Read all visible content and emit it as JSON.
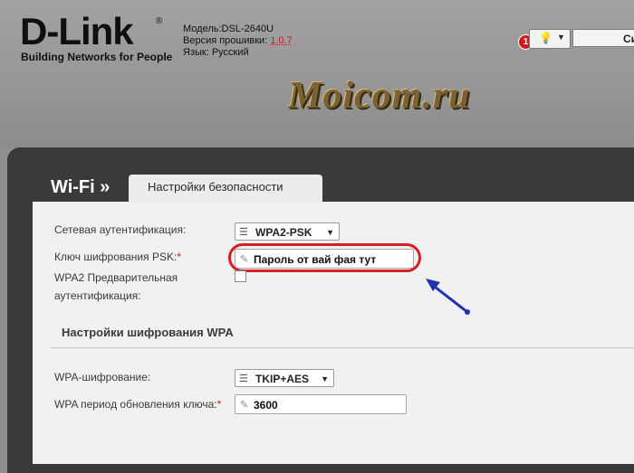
{
  "brand": {
    "logo": "D-Link",
    "reg": "®",
    "tagline": "Building Networks for People"
  },
  "device": {
    "model_label": "Модель:",
    "model": "DSL-2640U",
    "firmware_label": "Версия прошивки:",
    "firmware": "1.0.7",
    "language_label": "Язык:",
    "language": "Русский"
  },
  "notifications": {
    "count": "1"
  },
  "system_button": {
    "label": "Си"
  },
  "watermark": "Moicom.ru",
  "page": {
    "title": "Wi-Fi »",
    "tab": "Настройки безопасности"
  },
  "form": {
    "auth_label": "Сетевая аутентификация:",
    "auth_value": "WPA2-PSK",
    "psk_label": "Ключ шифрования PSK:",
    "psk_value": "Пароль от вай фая тут",
    "preauth_label_1": "WPA2 Предварительная",
    "preauth_label_2": "аутентификация:",
    "required_mark": "*",
    "wpa_section": "Настройки шифрования WPA",
    "wpa_enc_label": "WPA-шифрование:",
    "wpa_enc_value": "TKIP+AES",
    "rekey_label": "WPA период обновления ключа:",
    "rekey_value": "3600"
  },
  "colors": {
    "highlight": "#d71e24",
    "arrow": "#1f33b0",
    "frame": "#3a3a3a"
  }
}
